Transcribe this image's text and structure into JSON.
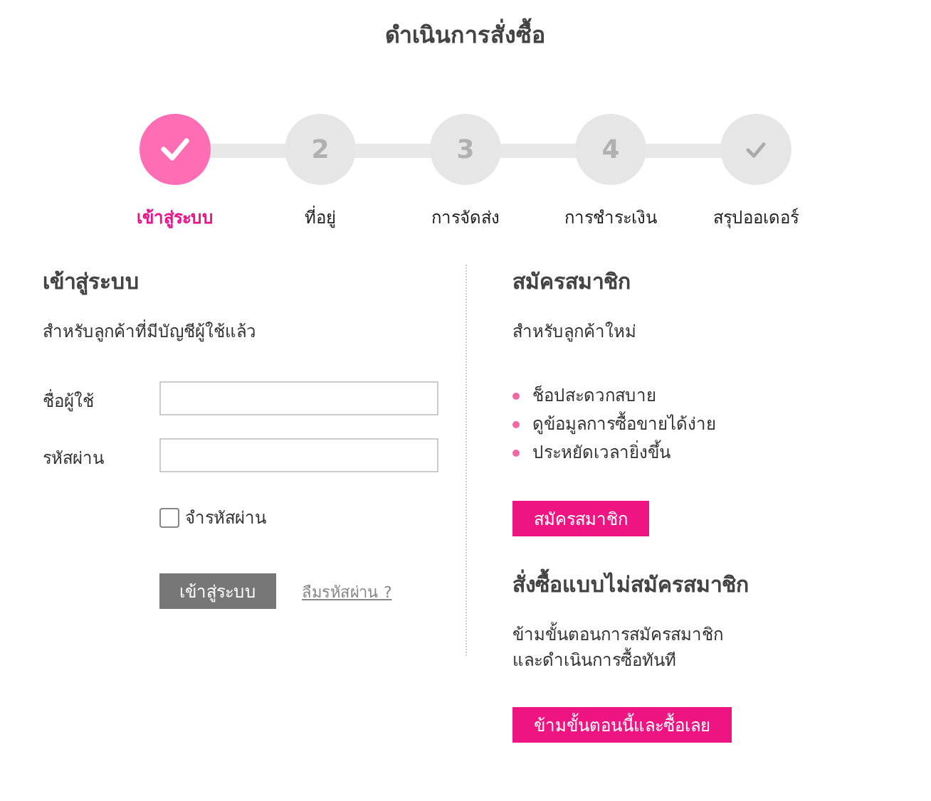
{
  "title": "ดำเนินการสั่งซื้อ",
  "steps": [
    {
      "label": "เข้าสู่ระบบ",
      "kind": "check",
      "selected": true
    },
    {
      "label": "ที่อยู่",
      "kind": "number",
      "number": "2",
      "selected": false
    },
    {
      "label": "การจัดส่ง",
      "kind": "number",
      "number": "3",
      "selected": false
    },
    {
      "label": "การชำระเงิน",
      "kind": "number",
      "number": "4",
      "selected": false
    },
    {
      "label": "สรุปออเดอร์",
      "kind": "check",
      "selected": false
    }
  ],
  "login": {
    "heading": "เข้าสู่ระบบ",
    "subtitle": "สำหรับลูกค้าที่มีบัญชีผู้ใช้แล้ว",
    "fields": [
      {
        "label": "ชื่อผู้ใช้"
      },
      {
        "label": "รหัสผ่าน"
      }
    ],
    "remember": {
      "label": "จำรหัสผ่าน",
      "checked": false
    },
    "submit": "เข้าสู่ระบบ",
    "forgot": "ลืมรหัสผ่าน ?"
  },
  "register": {
    "heading": "สมัครสมาชิก",
    "subtitle": "สำหรับลูกค้าใหม่",
    "benefits": [
      "ช็อปสะดวกสบาย",
      "ดูข้อมูลการซื้อขายได้ง่าย",
      "ประหยัดเวลายิ่งขึ้น"
    ],
    "button": "สมัครสมาชิก"
  },
  "guest": {
    "heading": "สั่งซื้อแบบไม่สมัครสมาชิก",
    "lines": [
      "ข้ามขั้นตอนการสมัครสมาชิก",
      "และดำเนินการซื้อทันที"
    ],
    "button": "ข้ามขั้นตอนนี้และซื้อเลย"
  }
}
